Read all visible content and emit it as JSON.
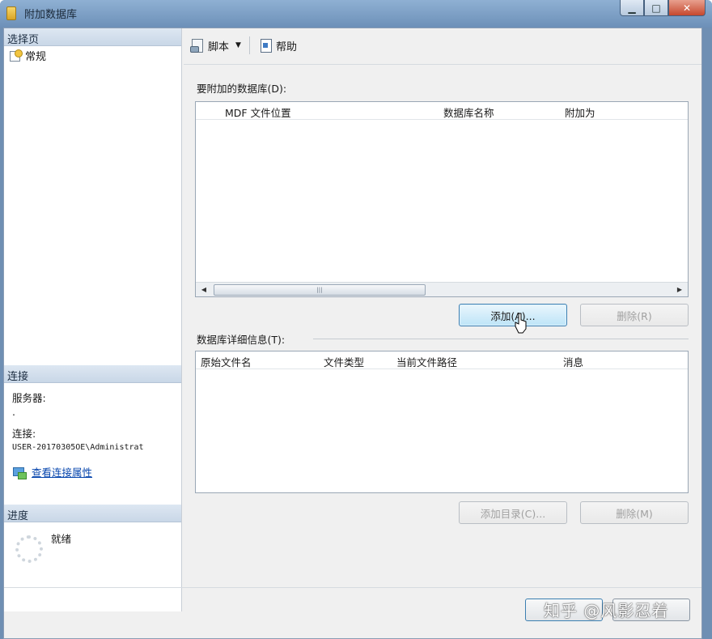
{
  "window": {
    "title": "附加数据库"
  },
  "left_pane": {
    "select_page_header": "选择页",
    "pages": [
      {
        "label": "常规",
        "icon": "general-page-icon"
      }
    ],
    "connection": {
      "header": "连接",
      "server_label": "服务器:",
      "server_value": ".",
      "connection_label": "连接:",
      "connection_value": "USER-20170305OE\\Administrat",
      "view_properties_link": "查看连接属性"
    },
    "progress": {
      "header": "进度",
      "status": "就绪"
    }
  },
  "toolbar": {
    "script_label": "脚本",
    "help_label": "帮助"
  },
  "databases_to_attach": {
    "label": "要附加的数据库(D):",
    "columns": [
      "MDF 文件位置",
      "数据库名称",
      "附加为"
    ],
    "rows": [],
    "add_button": "添加(A)...",
    "remove_button": "删除(R)"
  },
  "database_details": {
    "label": "数据库详细信息(T):",
    "columns": [
      "原始文件名",
      "文件类型",
      "当前文件路径",
      "消息"
    ],
    "rows": [],
    "add_catalog_button": "添加目录(C)...",
    "remove_button": "删除(M)"
  },
  "watermark": "知乎 @风影忍着"
}
